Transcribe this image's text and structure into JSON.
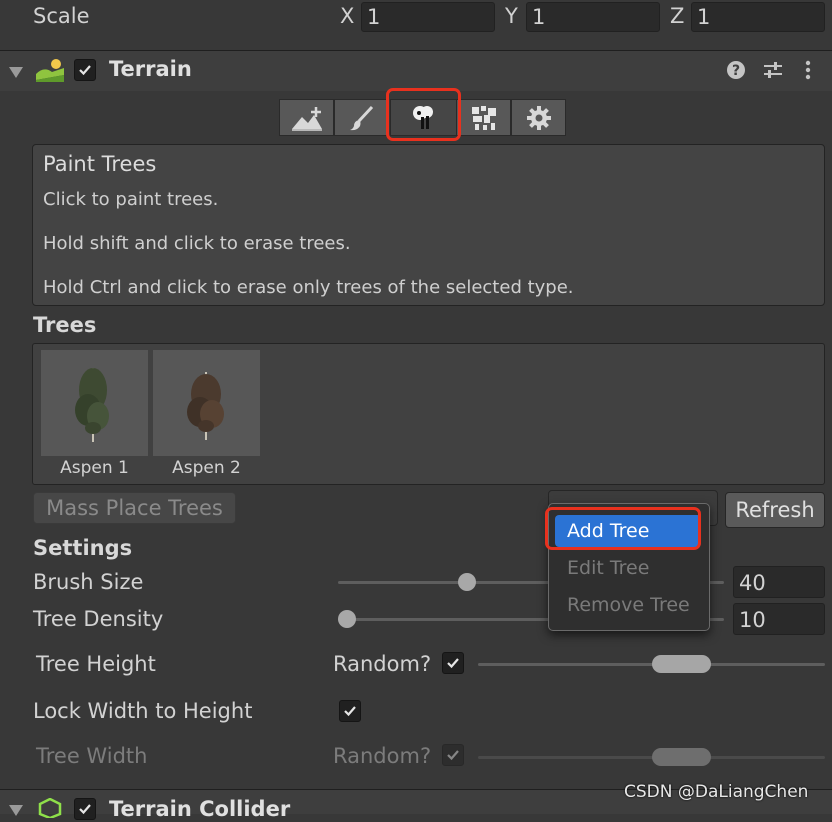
{
  "transform": {
    "scale_label": "Scale",
    "x_axis": "X",
    "x_value": "1",
    "y_axis": "Y",
    "y_value": "1",
    "z_axis": "Z",
    "z_value": "1"
  },
  "terrain": {
    "title": "Terrain",
    "enabled": true,
    "help_icon": "help-icon",
    "preset_icon": "presets-icon",
    "menu_icon": "kebab-menu-icon",
    "tools": [
      {
        "icon": "raise-lower-terrain-icon"
      },
      {
        "icon": "paint-brush-icon"
      },
      {
        "icon": "paint-trees-icon",
        "active": true
      },
      {
        "icon": "paint-details-icon"
      },
      {
        "icon": "settings-gear-icon"
      }
    ]
  },
  "help": {
    "title": "Paint Trees",
    "line1": "Click to paint trees.",
    "line2": "Hold shift and click to erase trees.",
    "line3": "Hold Ctrl and click to erase only trees of the selected type."
  },
  "trees": {
    "heading": "Trees",
    "items": [
      {
        "name": "Aspen 1"
      },
      {
        "name": "Aspen 2"
      }
    ],
    "mass_place": "Mass Place Trees",
    "refresh": "Refresh"
  },
  "context_menu": {
    "items": [
      "Add Tree",
      "Edit Tree",
      "Remove Tree"
    ]
  },
  "settings": {
    "heading": "Settings",
    "brush_size_label": "Brush Size",
    "brush_size_value": "40",
    "tree_density_label": "Tree Density",
    "tree_density_value": "10",
    "tree_height_label": "Tree Height",
    "random_label": "Random?",
    "lock_width_label": "Lock Width to Height",
    "tree_width_label": "Tree Width",
    "tree_width_random_label": "Random?"
  },
  "collider": {
    "title": "Terrain Collider"
  },
  "watermark": "CSDN @DaLiangChen"
}
